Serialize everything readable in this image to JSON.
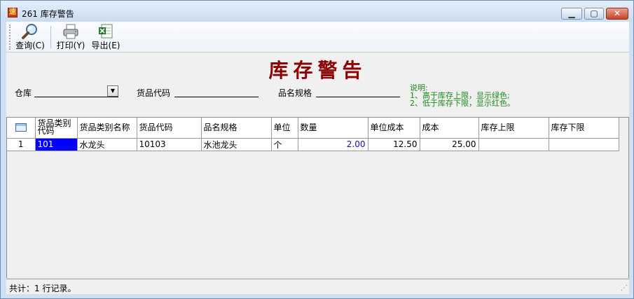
{
  "window": {
    "title": "261 库存警告",
    "icon": "app-logo-icon"
  },
  "toolbar": {
    "query_label": "查询(C)",
    "print_label": "打印(Y)",
    "export_label": "导出(E)"
  },
  "page": {
    "title": "库存警告"
  },
  "filters": {
    "warehouse_label": "仓库",
    "warehouse_value": "",
    "code_label": "货品代码",
    "code_value": "",
    "spec_label": "品名规格",
    "spec_value": ""
  },
  "note": {
    "line1": "说明:",
    "line2": "1、高于库存上限，显示绿色;",
    "line3": "2、低于库存下限，显示红色。",
    "color": "#1a8a1a"
  },
  "grid": {
    "columns": [
      "货品类别代码",
      "货品类别名称",
      "货品代码",
      "品名规格",
      "单位",
      "数量",
      "单位成本",
      "成本",
      "库存上限",
      "库存下限"
    ],
    "rows": [
      {
        "index": "1",
        "category_code": "101",
        "category_name": "水龙头",
        "item_code": "10103",
        "spec": "水池龙头",
        "unit": "个",
        "qty": "2.00",
        "unit_cost": "12.50",
        "cost": "25.00",
        "upper": "",
        "lower": ""
      }
    ]
  },
  "status": {
    "text": "共计：1 行记录。"
  }
}
